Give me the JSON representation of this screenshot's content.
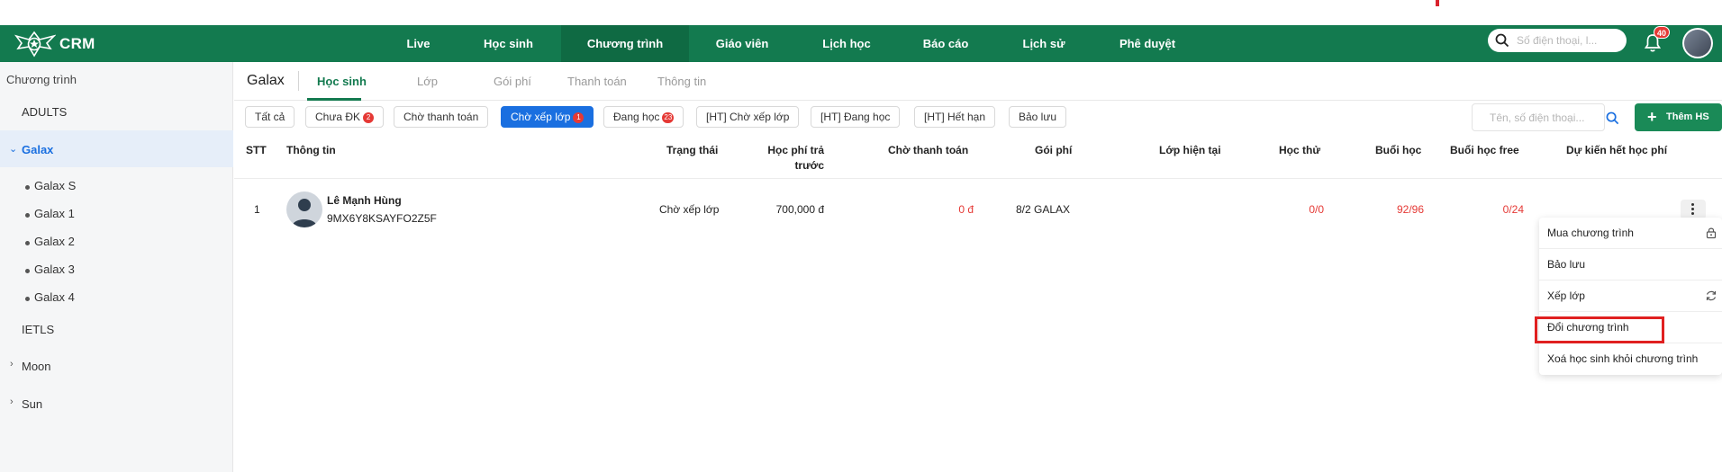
{
  "app": {
    "name": "CRM"
  },
  "nav": {
    "items": [
      "Live",
      "Học sinh",
      "Chương trình",
      "Giáo viên",
      "Lịch học",
      "Báo cáo",
      "Lịch sử",
      "Phê duyệt"
    ],
    "active": "Chương trình",
    "search_placeholder": "Số điện thoại, l...",
    "notifications_count": "40"
  },
  "sidebar": {
    "title": "Chương trình",
    "items": [
      {
        "label": "ADULTS"
      },
      {
        "label": "Galax",
        "expanded": true,
        "active": true
      },
      {
        "label": "Galax S"
      },
      {
        "label": "Galax 1"
      },
      {
        "label": "Galax 2"
      },
      {
        "label": "Galax 3"
      },
      {
        "label": "Galax 4"
      },
      {
        "label": "IETLS"
      },
      {
        "label": "Moon"
      },
      {
        "label": "Sun"
      }
    ]
  },
  "tabs": {
    "program": "Galax",
    "items": [
      "Học sinh",
      "Lớp",
      "Gói phí",
      "Thanh toán",
      "Thông tin"
    ],
    "active": "Học sinh"
  },
  "filters": [
    {
      "label": "Tất cả"
    },
    {
      "label": "Chưa ĐK",
      "badge": "2"
    },
    {
      "label": "Chờ thanh toán"
    },
    {
      "label": "Chờ xếp lớp",
      "badge": "1",
      "active": true
    },
    {
      "label": "Đang học",
      "badge": "23"
    },
    {
      "label": "[HT] Chờ xếp lớp"
    },
    {
      "label": "[HT] Đang học"
    },
    {
      "label": "[HT] Hết hạn"
    },
    {
      "label": "Bảo lưu"
    }
  ],
  "search": {
    "placeholder": "Tên, số điện thoại..."
  },
  "add_button": "Thêm HS",
  "table": {
    "headers": {
      "stt": "STT",
      "info": "Thông tin",
      "status": "Trạng thái",
      "prepaid_line1": "Học phí trả",
      "prepaid_line2": "trước",
      "pending": "Chờ thanh toán",
      "package": "Gói phí",
      "current_class": "Lớp hiện tại",
      "trial": "Học thử",
      "sessions": "Buổi học",
      "free_sessions": "Buổi học free",
      "expected_end": "Dự kiến hết học phí"
    },
    "rows": [
      {
        "stt": "1",
        "name": "Lê Mạnh Hùng",
        "code": "9MX6Y8KSAYFO2Z5F",
        "status": "Chờ xếp lớp",
        "prepaid": "700,000 đ",
        "pending": "0 đ",
        "package": "8/2 GALAX",
        "current_class": "",
        "trial": "0/0",
        "sessions": "92/96",
        "free_sessions": "0/24",
        "expected_end": ""
      }
    ]
  },
  "context_menu": {
    "items": [
      {
        "label": "Mua chương trình",
        "icon": "lock-icon"
      },
      {
        "label": "Bảo lưu"
      },
      {
        "label": "Xếp lớp",
        "icon": "refresh-icon"
      },
      {
        "label": "Đổi chương trình",
        "highlighted": true
      },
      {
        "label": "Xoá học sinh khỏi chương trình"
      }
    ]
  },
  "colors": {
    "nav_bg": "#137a4f",
    "primary_blue": "#1a6fe0",
    "badge_red": "#e53935",
    "highlight_red": "#e02020"
  }
}
